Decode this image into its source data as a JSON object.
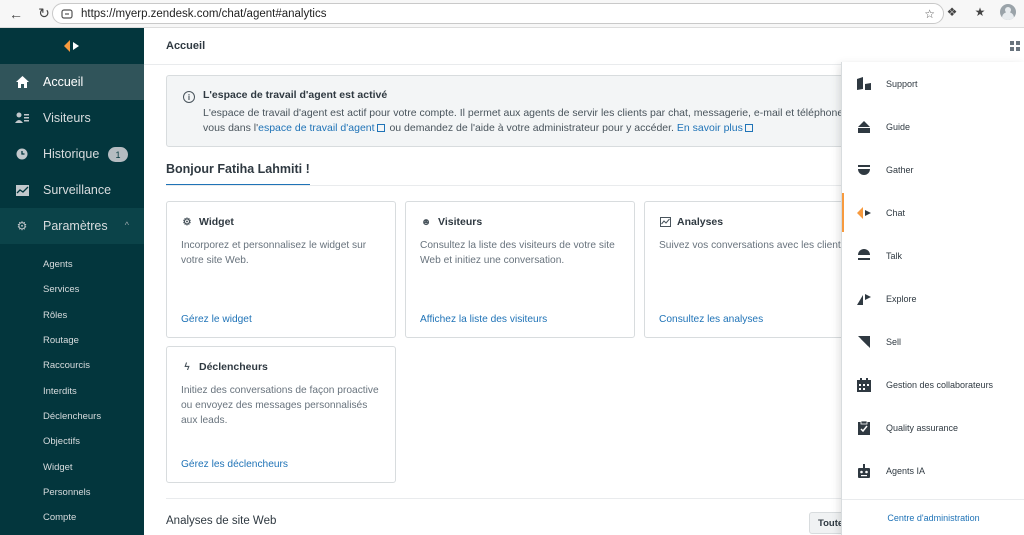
{
  "browser": {
    "url": "https://myerp.zendesk.com/chat/agent#analytics"
  },
  "sidebar": {
    "items": [
      {
        "label": "Accueil",
        "icon": "home-icon"
      },
      {
        "label": "Visiteurs",
        "icon": "visitors-icon"
      },
      {
        "label": "Historique",
        "icon": "history-icon",
        "badge": "1"
      },
      {
        "label": "Surveillance",
        "icon": "monitoring-icon"
      },
      {
        "label": "Paramètres",
        "icon": "gear-icon"
      }
    ],
    "subitems": [
      "Agents",
      "Services",
      "Rôles",
      "Routage",
      "Raccourcis",
      "Interdits",
      "Déclencheurs",
      "Objectifs",
      "Widget",
      "Personnels",
      "Compte"
    ]
  },
  "header": {
    "title": "Accueil"
  },
  "notice": {
    "title": "L'espace de travail d'agent est activé",
    "line1": "L'espace de travail d'agent est actif pour votre compte. Il permet aux agents de servir les clients par chat, messagerie, e-mail et téléphone au sei",
    "line2_prefix": "vous dans l'",
    "link1": "espace de travail d'agent",
    "line2_middle": " ou demandez de l'aide à votre administrateur pour y accéder. ",
    "link2": "En savoir plus"
  },
  "greeting": "Bonjour Fatiha Lahmiti !",
  "cards": [
    {
      "title": "Widget",
      "desc": "Incorporez et personnalisez le widget sur votre site Web.",
      "link": "Gérez le widget"
    },
    {
      "title": "Visiteurs",
      "desc": "Consultez la liste des visiteurs de votre site Web et initiez une conversation.",
      "link": "Affichez la liste des visiteurs"
    },
    {
      "title": "Analyses",
      "desc": "Suivez vos conversations avec les clients.",
      "link": "Consultez les analyses"
    },
    {
      "title": "Déclencheurs",
      "desc": "Initiez des conversations de façon proactive ou envoyez des messages personnalisés aux leads.",
      "link": "Gérez les déclencheurs"
    }
  ],
  "bottom": {
    "title": "Analyses de site Web",
    "button": "Toutes"
  },
  "tray": {
    "items": [
      "Support",
      "Guide",
      "Gather",
      "Chat",
      "Talk",
      "Explore",
      "Sell",
      "Gestion des collaborateurs",
      "Quality assurance",
      "Agents IA"
    ],
    "active": "Chat",
    "footer": "Centre d'administration"
  },
  "colors": {
    "sidebar": "#03363d",
    "accent": "#1f73b7",
    "chat_orange": "#f79a3e"
  }
}
